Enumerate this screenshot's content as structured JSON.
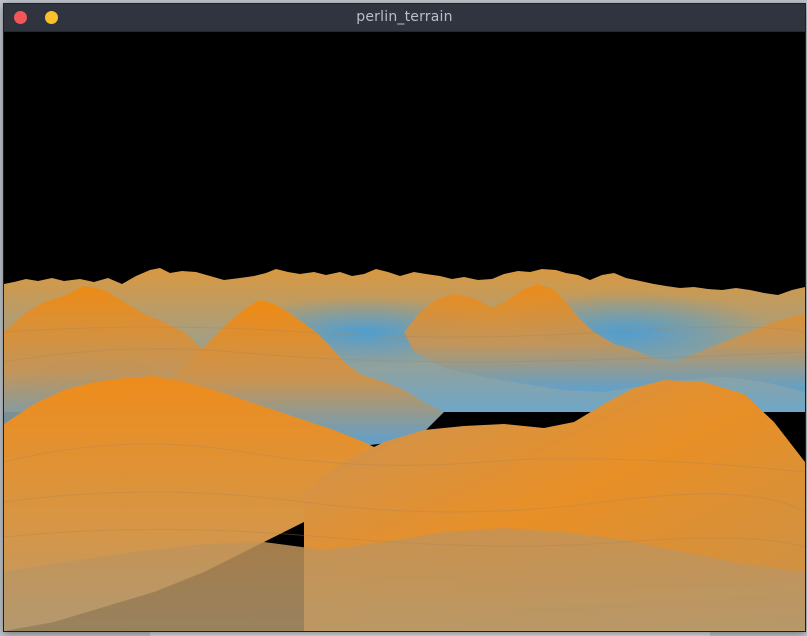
{
  "window": {
    "title": "perlin_terrain"
  },
  "controls": {
    "close_icon": "close-dot-icon",
    "minimize_icon": "minimize-dot-icon"
  },
  "colors": {
    "titlebar": "#2f343f",
    "title_text": "#b9bec7",
    "close": "#f2555a",
    "minimize": "#f8c12c",
    "sky": "#000000",
    "terrain_peak": "#f08a12",
    "terrain_valley": "#4fa0d8",
    "terrain_mid": "#c8924c"
  }
}
